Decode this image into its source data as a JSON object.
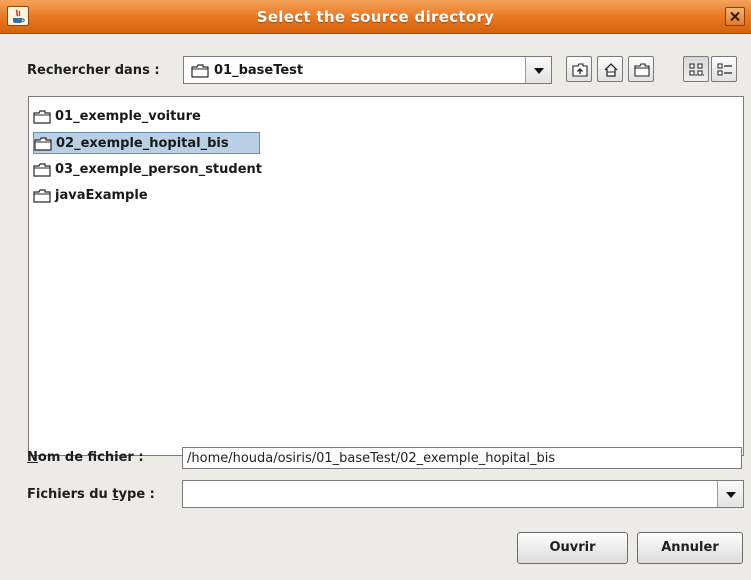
{
  "window": {
    "title": "Select the source directory"
  },
  "look_in": {
    "label": "Rechercher dans :",
    "value": "01_baseTest"
  },
  "toolbar": {
    "buttons": [
      {
        "icon": "up-folder-icon"
      },
      {
        "icon": "home-icon"
      },
      {
        "icon": "new-folder-icon"
      },
      {
        "icon": "list-view-icon",
        "pressed": true
      },
      {
        "icon": "details-view-icon"
      }
    ]
  },
  "files": [
    {
      "name": "01_exemple_voiture",
      "selected": false
    },
    {
      "name": "02_exemple_hopital_bis",
      "selected": true
    },
    {
      "name": "03_exemple_person_student",
      "selected": false
    },
    {
      "name": "javaExample",
      "selected": false
    }
  ],
  "filename": {
    "label_mnemonic": "N",
    "label_rest": "om de fichier :",
    "value": "/home/houda/osiris/01_baseTest/02_exemple_hopital_bis"
  },
  "filetype": {
    "label_pre": "Fichiers du ",
    "label_mnemonic": "t",
    "label_post": "ype :",
    "value": ""
  },
  "buttons": {
    "open": "Ouvrir",
    "cancel": "Annuler"
  },
  "colors": {
    "titlebar": "#e8761f",
    "selection": "#b8cfe5"
  }
}
